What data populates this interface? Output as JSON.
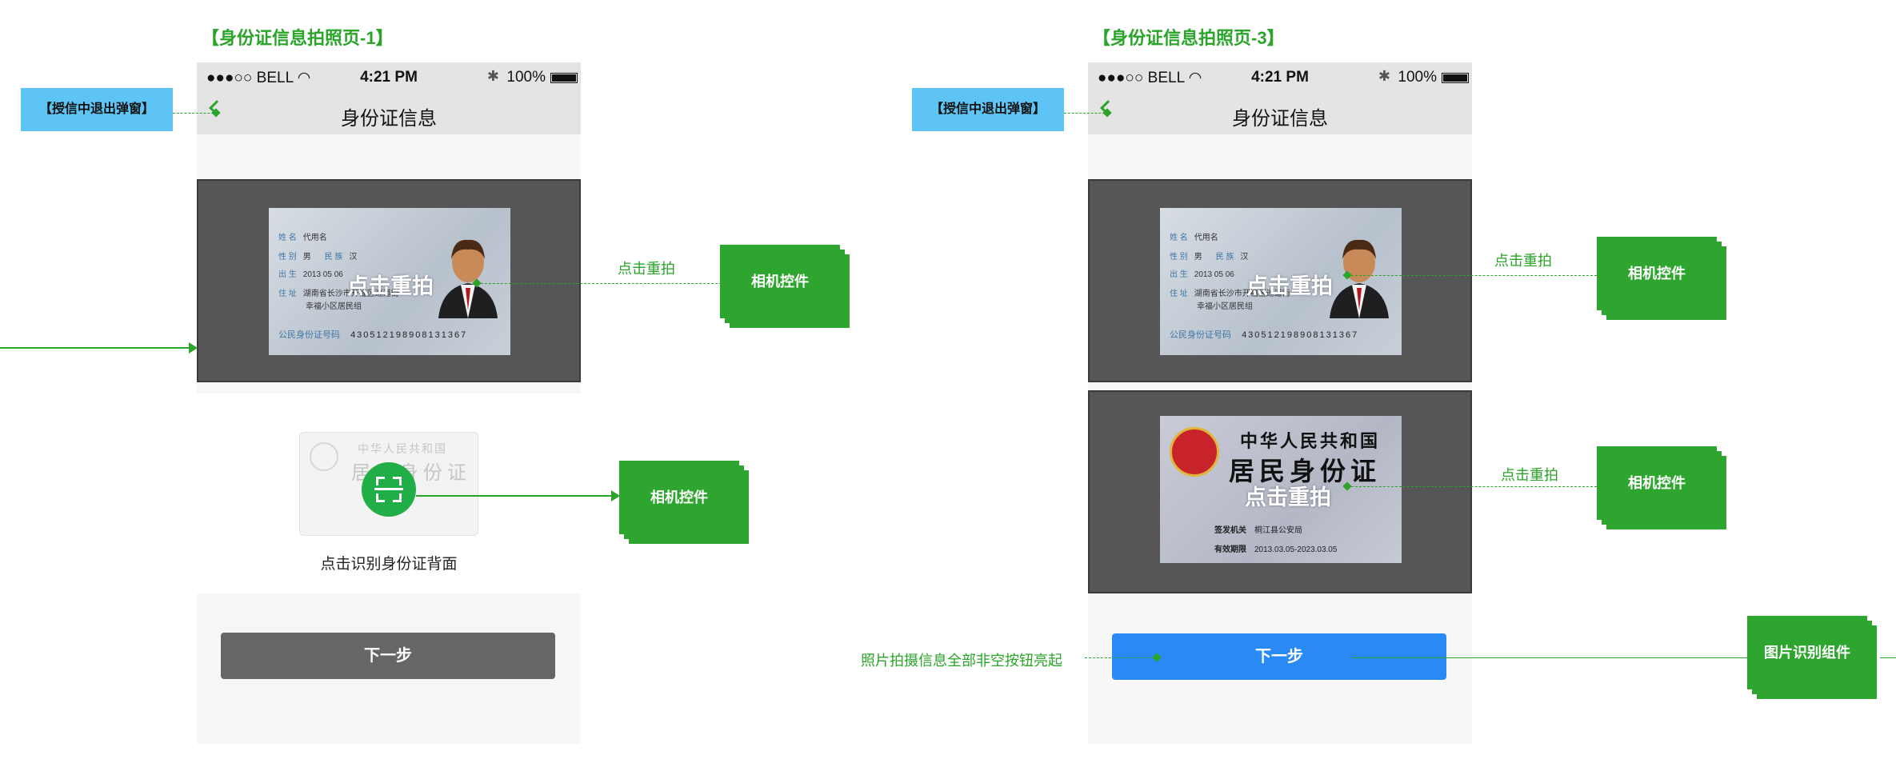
{
  "screens": [
    {
      "title": "【身份证信息拍照页-1】"
    },
    {
      "title": "【身份证信息拍照页-3】"
    }
  ],
  "statusbar": {
    "carrier": "●●●○○ BELL",
    "time": "4:21 PM",
    "battery": "100%"
  },
  "nav": {
    "title": "身份证信息"
  },
  "idcard_front": {
    "name_label": "姓 名",
    "name": "代用名",
    "gender_label": "性 别",
    "gender": "男",
    "ethnicity_label": "民 族",
    "ethnicity": "汉",
    "birth_label": "出 生",
    "birth": "2013  05  06",
    "address_label": "住 址",
    "address_1": "湖南省长沙市开福区巡道街",
    "address_2": "幸福小区居民组",
    "id_label": "公民身份证号码",
    "id_number": "430512198908131367"
  },
  "idcard_back": {
    "line1": "中华人民共和国",
    "line2": "居民身份证",
    "issuer_label": "签发机关",
    "issuer": "桐江县公安局",
    "valid_label": "有效期限",
    "valid": "2013.03.05-2023.03.05"
  },
  "retake_label": "点击重拍",
  "scan": {
    "faded_line1": "中华人民共和国",
    "faded_line2": "居民身份证",
    "label": "点击识别身份证背面"
  },
  "next_label": "下一步",
  "annotations": {
    "exit_popup": "【授信中退出弹窗】",
    "retake_note": "点击重拍",
    "camera_control": "相机控件",
    "image_recognition": "图片识别组件",
    "button_note": "照片拍摄信息全部非空按钮亮起"
  },
  "colors": {
    "accent_green": "#2aa52a",
    "button_disabled": "#666666",
    "button_active": "#2a8af5",
    "note_blue": "#5ec4f4",
    "scan_green": "#21ae47"
  }
}
